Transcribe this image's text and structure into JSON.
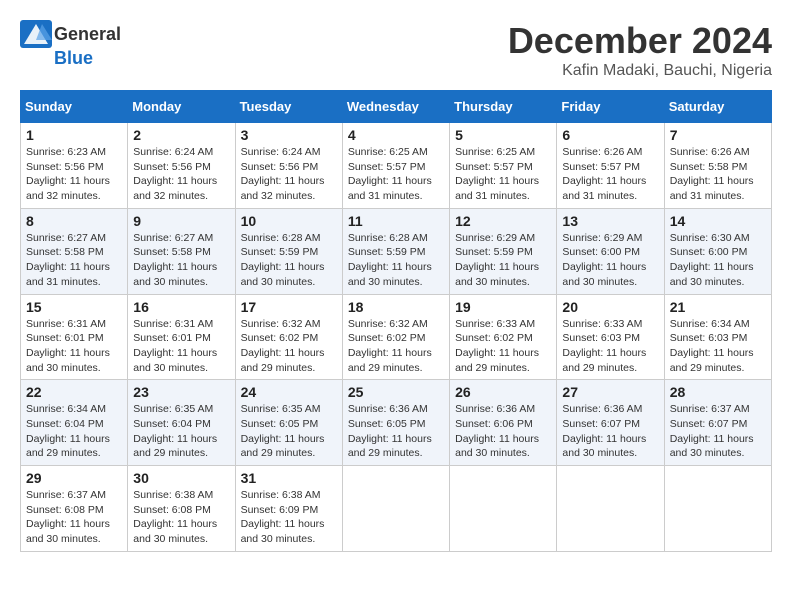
{
  "logo": {
    "general": "General",
    "blue": "Blue"
  },
  "title": {
    "month": "December 2024",
    "location": "Kafin Madaki, Bauchi, Nigeria"
  },
  "weekdays": [
    "Sunday",
    "Monday",
    "Tuesday",
    "Wednesday",
    "Thursday",
    "Friday",
    "Saturday"
  ],
  "weeks": [
    [
      {
        "day": "1",
        "info": "Sunrise: 6:23 AM\nSunset: 5:56 PM\nDaylight: 11 hours\nand 32 minutes."
      },
      {
        "day": "2",
        "info": "Sunrise: 6:24 AM\nSunset: 5:56 PM\nDaylight: 11 hours\nand 32 minutes."
      },
      {
        "day": "3",
        "info": "Sunrise: 6:24 AM\nSunset: 5:56 PM\nDaylight: 11 hours\nand 32 minutes."
      },
      {
        "day": "4",
        "info": "Sunrise: 6:25 AM\nSunset: 5:57 PM\nDaylight: 11 hours\nand 31 minutes."
      },
      {
        "day": "5",
        "info": "Sunrise: 6:25 AM\nSunset: 5:57 PM\nDaylight: 11 hours\nand 31 minutes."
      },
      {
        "day": "6",
        "info": "Sunrise: 6:26 AM\nSunset: 5:57 PM\nDaylight: 11 hours\nand 31 minutes."
      },
      {
        "day": "7",
        "info": "Sunrise: 6:26 AM\nSunset: 5:58 PM\nDaylight: 11 hours\nand 31 minutes."
      }
    ],
    [
      {
        "day": "8",
        "info": "Sunrise: 6:27 AM\nSunset: 5:58 PM\nDaylight: 11 hours\nand 31 minutes."
      },
      {
        "day": "9",
        "info": "Sunrise: 6:27 AM\nSunset: 5:58 PM\nDaylight: 11 hours\nand 30 minutes."
      },
      {
        "day": "10",
        "info": "Sunrise: 6:28 AM\nSunset: 5:59 PM\nDaylight: 11 hours\nand 30 minutes."
      },
      {
        "day": "11",
        "info": "Sunrise: 6:28 AM\nSunset: 5:59 PM\nDaylight: 11 hours\nand 30 minutes."
      },
      {
        "day": "12",
        "info": "Sunrise: 6:29 AM\nSunset: 5:59 PM\nDaylight: 11 hours\nand 30 minutes."
      },
      {
        "day": "13",
        "info": "Sunrise: 6:29 AM\nSunset: 6:00 PM\nDaylight: 11 hours\nand 30 minutes."
      },
      {
        "day": "14",
        "info": "Sunrise: 6:30 AM\nSunset: 6:00 PM\nDaylight: 11 hours\nand 30 minutes."
      }
    ],
    [
      {
        "day": "15",
        "info": "Sunrise: 6:31 AM\nSunset: 6:01 PM\nDaylight: 11 hours\nand 30 minutes."
      },
      {
        "day": "16",
        "info": "Sunrise: 6:31 AM\nSunset: 6:01 PM\nDaylight: 11 hours\nand 30 minutes."
      },
      {
        "day": "17",
        "info": "Sunrise: 6:32 AM\nSunset: 6:02 PM\nDaylight: 11 hours\nand 29 minutes."
      },
      {
        "day": "18",
        "info": "Sunrise: 6:32 AM\nSunset: 6:02 PM\nDaylight: 11 hours\nand 29 minutes."
      },
      {
        "day": "19",
        "info": "Sunrise: 6:33 AM\nSunset: 6:02 PM\nDaylight: 11 hours\nand 29 minutes."
      },
      {
        "day": "20",
        "info": "Sunrise: 6:33 AM\nSunset: 6:03 PM\nDaylight: 11 hours\nand 29 minutes."
      },
      {
        "day": "21",
        "info": "Sunrise: 6:34 AM\nSunset: 6:03 PM\nDaylight: 11 hours\nand 29 minutes."
      }
    ],
    [
      {
        "day": "22",
        "info": "Sunrise: 6:34 AM\nSunset: 6:04 PM\nDaylight: 11 hours\nand 29 minutes."
      },
      {
        "day": "23",
        "info": "Sunrise: 6:35 AM\nSunset: 6:04 PM\nDaylight: 11 hours\nand 29 minutes."
      },
      {
        "day": "24",
        "info": "Sunrise: 6:35 AM\nSunset: 6:05 PM\nDaylight: 11 hours\nand 29 minutes."
      },
      {
        "day": "25",
        "info": "Sunrise: 6:36 AM\nSunset: 6:05 PM\nDaylight: 11 hours\nand 29 minutes."
      },
      {
        "day": "26",
        "info": "Sunrise: 6:36 AM\nSunset: 6:06 PM\nDaylight: 11 hours\nand 30 minutes."
      },
      {
        "day": "27",
        "info": "Sunrise: 6:36 AM\nSunset: 6:07 PM\nDaylight: 11 hours\nand 30 minutes."
      },
      {
        "day": "28",
        "info": "Sunrise: 6:37 AM\nSunset: 6:07 PM\nDaylight: 11 hours\nand 30 minutes."
      }
    ],
    [
      {
        "day": "29",
        "info": "Sunrise: 6:37 AM\nSunset: 6:08 PM\nDaylight: 11 hours\nand 30 minutes."
      },
      {
        "day": "30",
        "info": "Sunrise: 6:38 AM\nSunset: 6:08 PM\nDaylight: 11 hours\nand 30 minutes."
      },
      {
        "day": "31",
        "info": "Sunrise: 6:38 AM\nSunset: 6:09 PM\nDaylight: 11 hours\nand 30 minutes."
      },
      null,
      null,
      null,
      null
    ]
  ]
}
